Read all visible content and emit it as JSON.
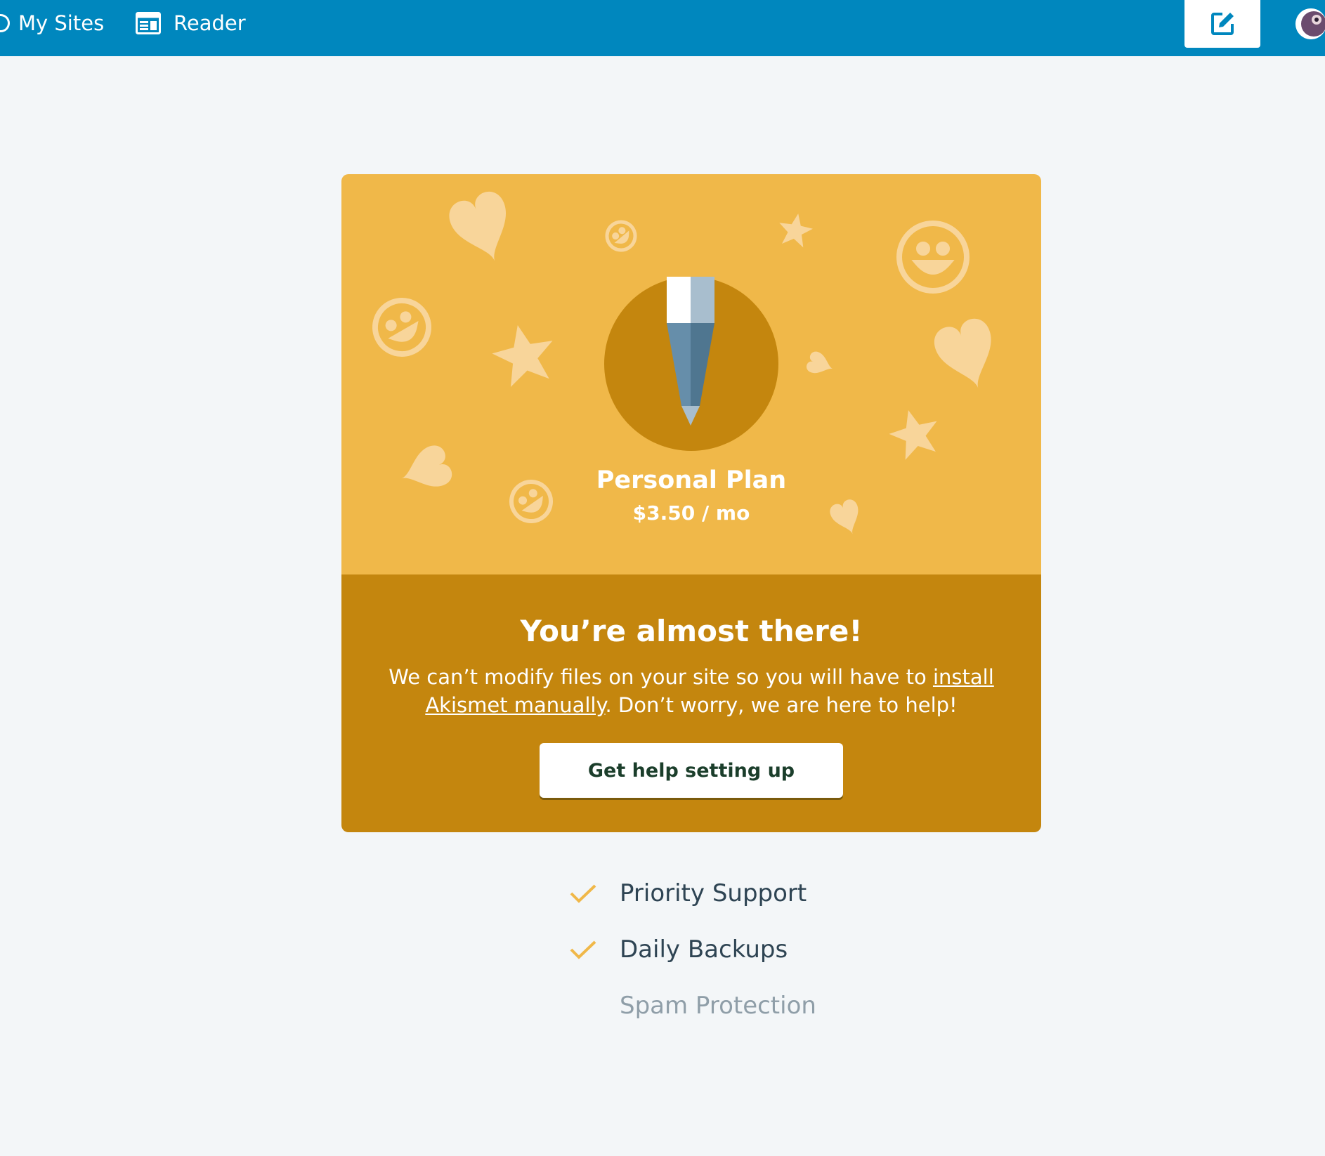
{
  "topbar": {
    "my_sites_label": "My Sites",
    "reader_label": "Reader",
    "icons": [
      "wordpress-icon",
      "reader-icon",
      "edit-icon",
      "avatar"
    ],
    "brand_color": "#0087be"
  },
  "plan": {
    "name": "Personal Plan",
    "price": "$3.50 / mo",
    "hero_color": "#f0b849",
    "body_color": "#c4860e"
  },
  "message": {
    "heading": "You’re almost there!",
    "text_before": "We can’t modify files on your site so you will have to ",
    "link_text": "install Akismet manually",
    "text_after": ". Don’t worry, we are here to help!"
  },
  "cta": {
    "label": "Get help setting up"
  },
  "features": [
    {
      "label": "Priority Support",
      "checked": true
    },
    {
      "label": "Daily Backups",
      "checked": true
    },
    {
      "label": "Spam Protection",
      "checked": false
    }
  ]
}
